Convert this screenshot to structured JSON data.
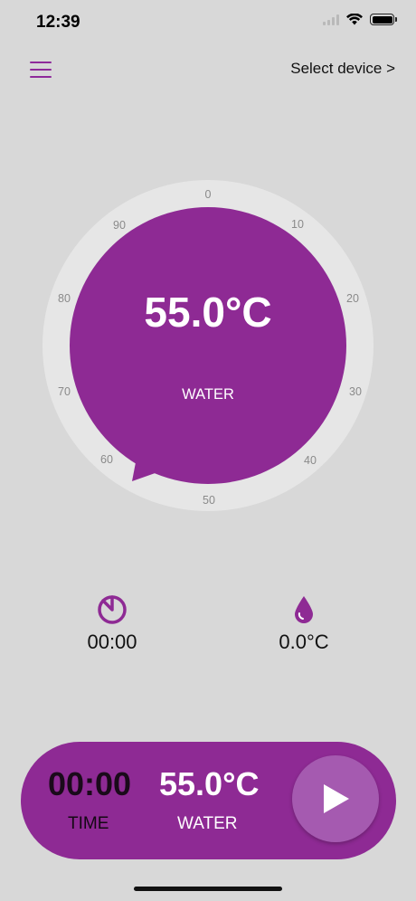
{
  "status": {
    "time": "12:39"
  },
  "header": {
    "menu_icon": "hamburger-menu-icon",
    "select_device": "Select device >"
  },
  "dial": {
    "temperature": "55.0°C",
    "mode": "WATER",
    "ticks": [
      "0",
      "10",
      "20",
      "30",
      "40",
      "50",
      "60",
      "70",
      "80",
      "90"
    ],
    "accent": "#8e2a94"
  },
  "stats": {
    "timer_icon": "timer-icon",
    "timer_value": "00:00",
    "drop_icon": "water-drop-icon",
    "drop_value": "0.0°C"
  },
  "bottom": {
    "time_value": "00:00",
    "time_label": "TIME",
    "temp_value": "55.0°C",
    "temp_label": "WATER",
    "play_icon": "play-icon"
  }
}
